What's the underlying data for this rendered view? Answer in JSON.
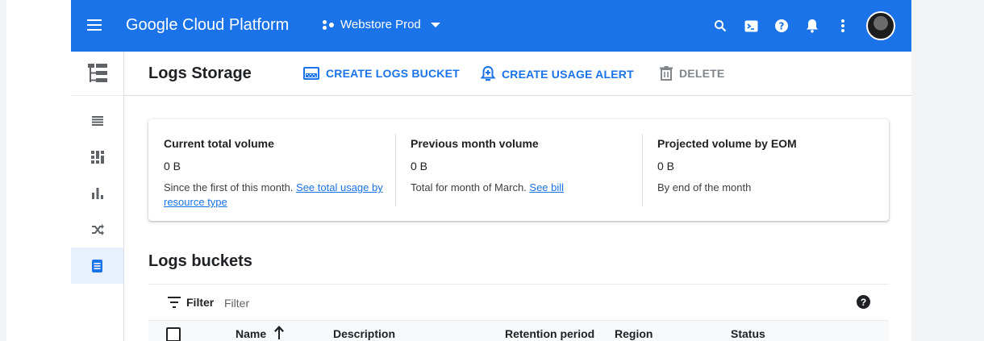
{
  "topbar": {
    "brand": "Google Cloud Platform",
    "project": "Webstore Prod",
    "icons": [
      "menu-icon",
      "search-icon",
      "cloud-shell-icon",
      "help-icon",
      "notifications-icon",
      "more-vert-icon",
      "account-avatar"
    ]
  },
  "sidenav": {
    "items": [
      "logs-viewer-icon",
      "dashboard-icon",
      "metrics-icon",
      "router-icon",
      "logs-storage-icon"
    ],
    "active": "logs-storage-icon"
  },
  "actionbar": {
    "title": "Logs Storage",
    "create_bucket": "CREATE LOGS BUCKET",
    "create_alert": "CREATE USAGE ALERT",
    "delete": "DELETE"
  },
  "summary": {
    "current": {
      "label": "Current total volume",
      "value": "0 B",
      "desc": "Since the first of this month.",
      "link": "See total usage by resource type"
    },
    "previous": {
      "label": "Previous month volume",
      "value": "0 B",
      "desc": "Total for month of March.",
      "link": "See bill"
    },
    "projected": {
      "label": "Projected volume by EOM",
      "value": "0 B",
      "desc": "By end of the month"
    }
  },
  "buckets": {
    "title": "Logs buckets",
    "filter_label": "Filter",
    "filter_placeholder": "Filter",
    "columns": {
      "name": "Name",
      "description": "Description",
      "retention": "Retention period",
      "region": "Region",
      "status": "Status"
    }
  },
  "colors": {
    "brand_blue": "#1a73e8",
    "active_nav_bg": "#e8f0fe",
    "disabled_gray": "#80868b"
  }
}
